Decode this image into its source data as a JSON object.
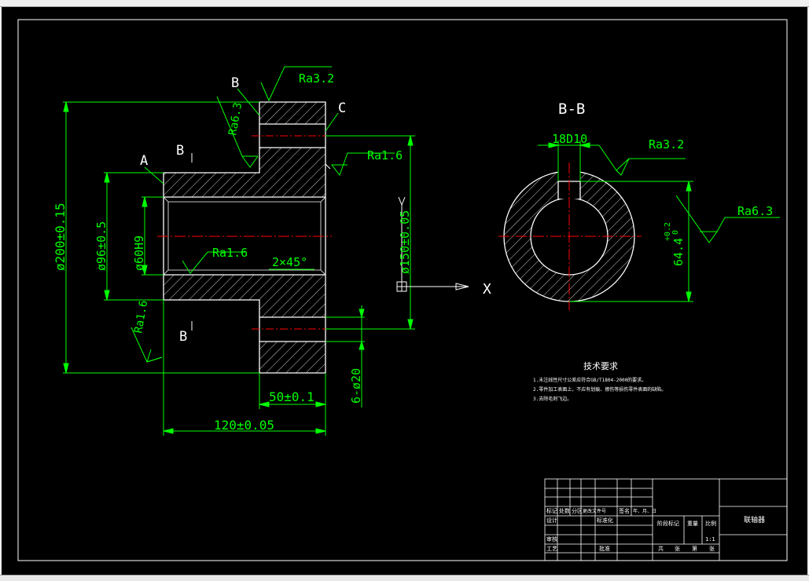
{
  "drawing": {
    "view_labels": {
      "A": "A",
      "B": "B",
      "C": "C",
      "section_label": "B-B",
      "axis_x": "X"
    },
    "roughness": {
      "top_ra32": "Ra3.2",
      "ra63_left": "Ra6.3",
      "ra16_right": "Ra1.6",
      "ra16_bore": "Ra1.6",
      "ra16_face": "Ra1.6",
      "section_ra32": "Ra3.2",
      "section_ra63": "Ra6.3"
    },
    "dimensions": {
      "outer_dia": "ø200±0.15",
      "hub_dia": "ø96±0.5",
      "bore_dia": "ø60H9",
      "pitch_dia": "ø150±0.05",
      "chamfer": "2×45°",
      "flange_width": "50±0.1",
      "total_length": "120±0.05",
      "holes": "6-ø20",
      "keyway_width": "18D10",
      "keyway_depth": "64.4",
      "keyway_tol_upper": "+0.2",
      "keyway_tol_lower": "0"
    },
    "tech_notes": {
      "title": "技术要求",
      "items": [
        "1.未注线性尺寸公差应符合GB/T1804-2000的要求。",
        "2.零件加工表面上，不应有划痕、擦伤等损伤零件表面的缺陷。",
        "3.去除毛刺飞边。"
      ]
    },
    "title_block": {
      "part_name": "联轴器",
      "scale": "1:1",
      "row_labels": [
        "标记",
        "处数",
        "分区",
        "更改文件号",
        "签名",
        "年、月、日"
      ],
      "design": "设计",
      "standard": "标准化",
      "stage_mark": "阶段标记",
      "weight": "重量",
      "ratio": "比例",
      "review": "审核",
      "process": "工艺",
      "approve": "批准",
      "sheets": [
        "共",
        "张",
        "第",
        "张"
      ]
    }
  },
  "colors": {
    "background": "#000000",
    "geometry": "#ffffff",
    "dimension": "#00ff00",
    "centerline": "#ff0000",
    "notes": "#ffffff"
  }
}
